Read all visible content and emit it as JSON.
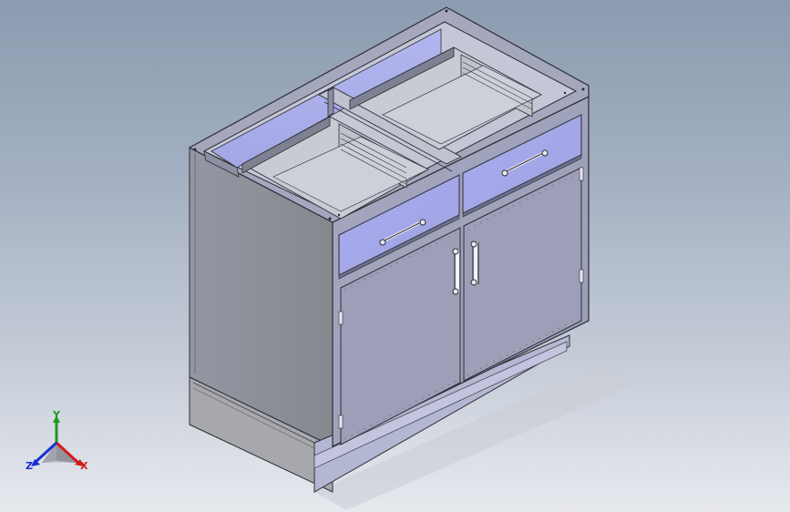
{
  "viewport": {
    "background_top": "#8c9bb0",
    "background_bottom": "#e7e9ee"
  },
  "model": {
    "name": "",
    "part_color": "#a9aec8",
    "highlight_color": "#a5a9f0",
    "edge_color": "#2c2c34",
    "drawer_count": 2,
    "door_count": 2,
    "handle_icons": [
      "drawer-handle-icon",
      "drawer-handle-icon",
      "door-handle-icon",
      "door-handle-icon"
    ]
  },
  "triad": {
    "icon": "orientation-triad-icon",
    "x_label": "X",
    "y_label": "Y",
    "z_label": "Z",
    "x_color": "#d21c1c",
    "y_color": "#1a9a1a",
    "z_color": "#1b2fd4"
  }
}
